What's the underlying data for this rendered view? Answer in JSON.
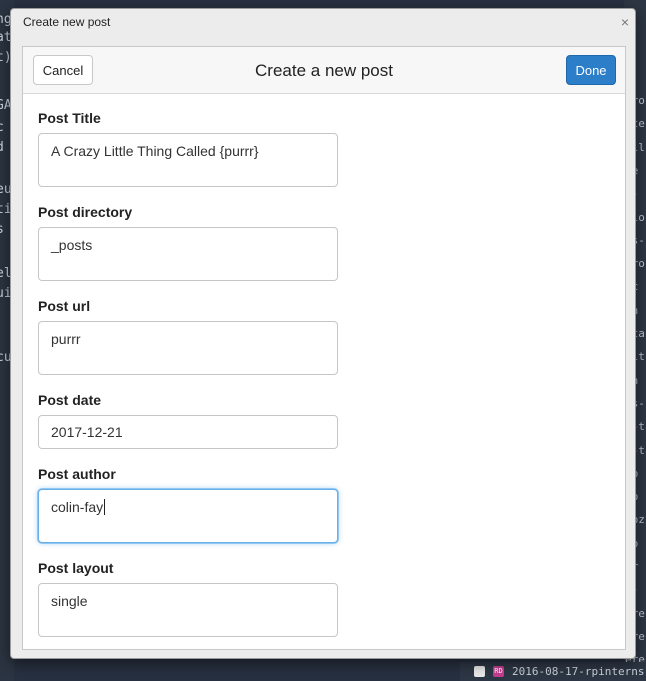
{
  "window": {
    "title": "Create new post",
    "close_glyph": "×"
  },
  "dialog": {
    "title": "Create a new post",
    "cancel_label": "Cancel",
    "done_label": "Done"
  },
  "fields": {
    "title": {
      "label": "Post Title",
      "value": "A Crazy Little Thing Called {purrr}"
    },
    "directory": {
      "label": "Post directory",
      "value": "_posts"
    },
    "url": {
      "label": "Post url",
      "value": "purrr"
    },
    "date": {
      "label": "Post date",
      "value": "2017-12-21"
    },
    "author": {
      "label": "Post author",
      "value": "colin-fay"
    },
    "layout": {
      "label": "Post layout",
      "value": "single"
    }
  },
  "background": {
    "left_fragments": [
      "ng",
      "at",
      "t)",
      "GA",
      "c",
      "d",
      "eu",
      "ti",
      "s",
      "el",
      "ui",
      "cu"
    ],
    "right_fragments": [
      "aro",
      "ete",
      "ell",
      "he",
      "d-",
      "olo",
      "is-",
      "aro",
      "-c",
      "ch",
      "nta",
      "alt",
      "en",
      "es-",
      "s-t",
      "s-t",
      "ap",
      "ap",
      "-bz",
      "ap",
      "-r",
      "e-",
      "ere",
      "ere",
      "ere"
    ],
    "bottom_file": "2016-08-17-rpinterns"
  },
  "colors": {
    "accent": "#2c7ec8",
    "focus": "#66afe9"
  }
}
